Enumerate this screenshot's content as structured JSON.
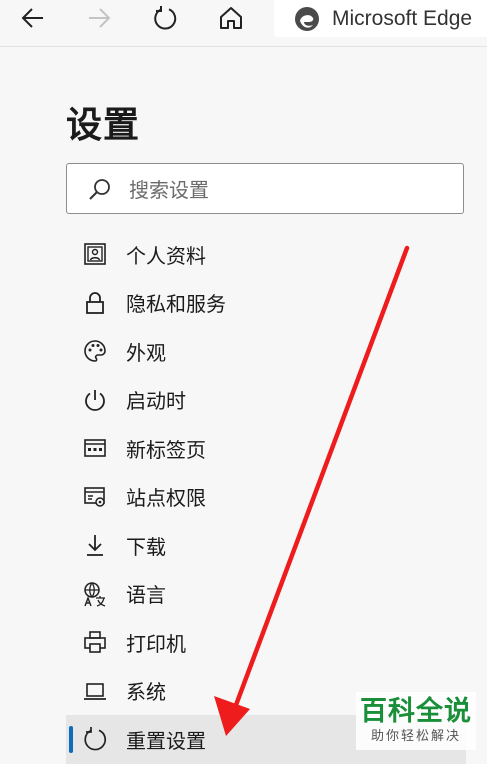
{
  "browser": {
    "tab_title": "Microsoft Edge",
    "back_icon": "back-arrow-icon",
    "forward_icon": "forward-arrow-icon",
    "refresh_icon": "refresh-icon",
    "home_icon": "home-icon"
  },
  "settings": {
    "title": "设置",
    "search_placeholder": "搜索设置",
    "nav": [
      {
        "label": "个人资料",
        "icon": "profile-icon"
      },
      {
        "label": "隐私和服务",
        "icon": "lock-icon"
      },
      {
        "label": "外观",
        "icon": "palette-icon"
      },
      {
        "label": "启动时",
        "icon": "power-icon"
      },
      {
        "label": "新标签页",
        "icon": "new-tab-icon"
      },
      {
        "label": "站点权限",
        "icon": "site-permissions-icon"
      },
      {
        "label": "下载",
        "icon": "download-icon"
      },
      {
        "label": "语言",
        "icon": "language-icon"
      },
      {
        "label": "打印机",
        "icon": "printer-icon"
      },
      {
        "label": "系统",
        "icon": "laptop-icon"
      },
      {
        "label": "重置设置",
        "icon": "reset-icon"
      }
    ],
    "active_index": 10
  },
  "annotation": {
    "color": "#ee1c1c"
  },
  "watermark": {
    "main": "百科全说",
    "sub": "助你轻松解决"
  },
  "colors": {
    "accent": "#0f6cbd",
    "background": "#f7f7f7"
  }
}
